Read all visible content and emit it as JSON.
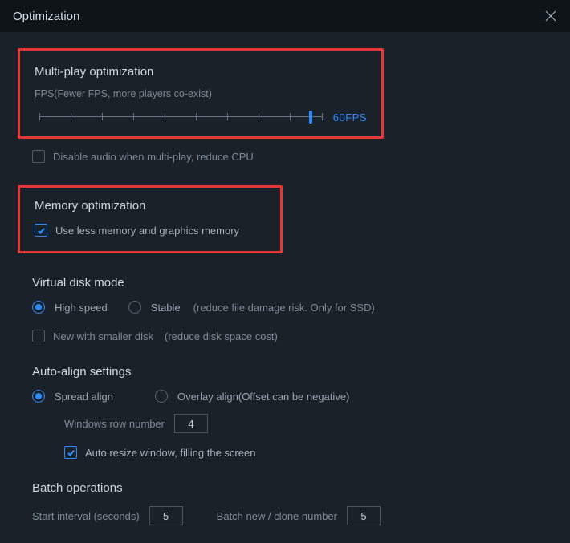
{
  "title": "Optimization",
  "multi": {
    "title": "Multi-play optimization",
    "fps_label": "FPS(Fewer FPS, more players co-exist)",
    "fps_value": "60FPS",
    "slider_pos_pct": 96,
    "disable_audio_label": "Disable audio when multi-play, reduce CPU",
    "disable_audio_checked": false
  },
  "memory": {
    "title": "Memory optimization",
    "use_less_label": "Use less memory and graphics memory",
    "use_less_checked": true
  },
  "disk": {
    "title": "Virtual disk mode",
    "high_speed_label": "High speed",
    "stable_label": "Stable",
    "stable_hint": "(reduce file damage risk. Only for SSD)",
    "selected": "high_speed",
    "smaller_disk_label": "New with smaller disk",
    "smaller_disk_hint": "(reduce disk space cost)",
    "smaller_disk_checked": false
  },
  "align": {
    "title": "Auto-align settings",
    "spread_label": "Spread align",
    "overlay_label": "Overlay align(Offset can be negative)",
    "selected": "spread",
    "row_number_label": "Windows row number",
    "row_number_value": "4",
    "auto_resize_label": "Auto resize window, filling the screen",
    "auto_resize_checked": true
  },
  "batch": {
    "title": "Batch operations",
    "start_interval_label": "Start interval (seconds)",
    "start_interval_value": "5",
    "clone_label": "Batch new / clone number",
    "clone_value": "5"
  }
}
